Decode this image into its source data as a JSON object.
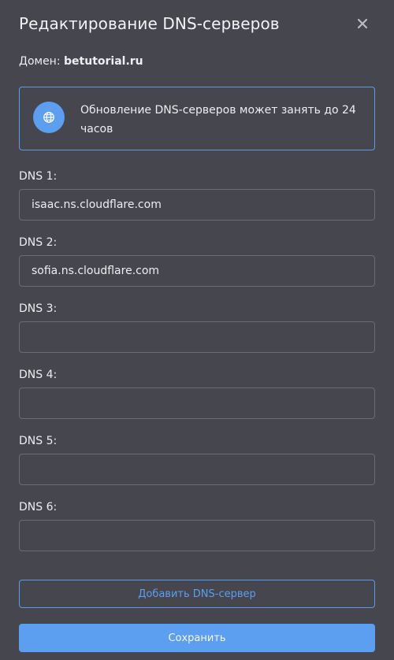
{
  "modal": {
    "title": "Редактирование DNS-серверов",
    "close_icon": "close-icon"
  },
  "domain": {
    "label": "Домен:",
    "value": "betutorial.ru"
  },
  "info": {
    "icon": "globe-icon",
    "text": "Обновление DNS-серверов может занять до 24 часов"
  },
  "dns_fields": [
    {
      "label": "DNS 1:",
      "value": "isaac.ns.cloudflare.com"
    },
    {
      "label": "DNS 2:",
      "value": "sofia.ns.cloudflare.com"
    },
    {
      "label": "DNS 3:",
      "value": ""
    },
    {
      "label": "DNS 4:",
      "value": ""
    },
    {
      "label": "DNS 5:",
      "value": ""
    },
    {
      "label": "DNS 6:",
      "value": ""
    }
  ],
  "actions": {
    "add_label": "Добавить DNS-сервер",
    "save_label": "Сохранить"
  },
  "colors": {
    "accent": "#5c9ef0",
    "background": "#45464e",
    "input_border": "#6c6d74"
  }
}
